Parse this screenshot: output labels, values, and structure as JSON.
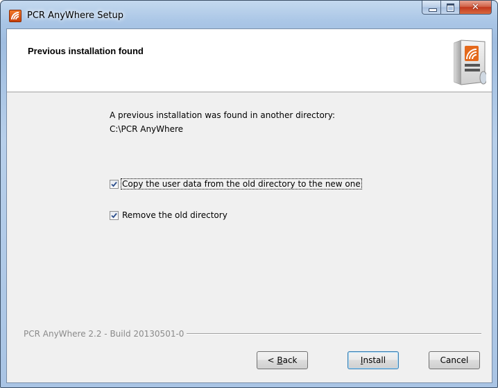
{
  "window": {
    "title": "PCR AnyWhere Setup"
  },
  "header": {
    "title": "Previous installation found"
  },
  "body": {
    "line1": "A previous installation was found in another directory:",
    "line2": "C:\\PCR AnyWhere"
  },
  "options": [
    {
      "label": "Copy the user data from the old directory to the new one",
      "checked": true
    },
    {
      "label": "Remove the old directory",
      "checked": true
    }
  ],
  "footer": {
    "branding": "PCR AnyWhere 2.2 - Build 20130501-0"
  },
  "buttons": {
    "back_prefix": "<",
    "back_mnemonic": "B",
    "back_rest": "ack",
    "install_mnemonic": "I",
    "install_rest": "nstall",
    "cancel": "Cancel"
  },
  "colors": {
    "accent_orange": "#e4691c",
    "checkmark": "#2c4f8c",
    "default_button_border": "#3c7fb1"
  }
}
